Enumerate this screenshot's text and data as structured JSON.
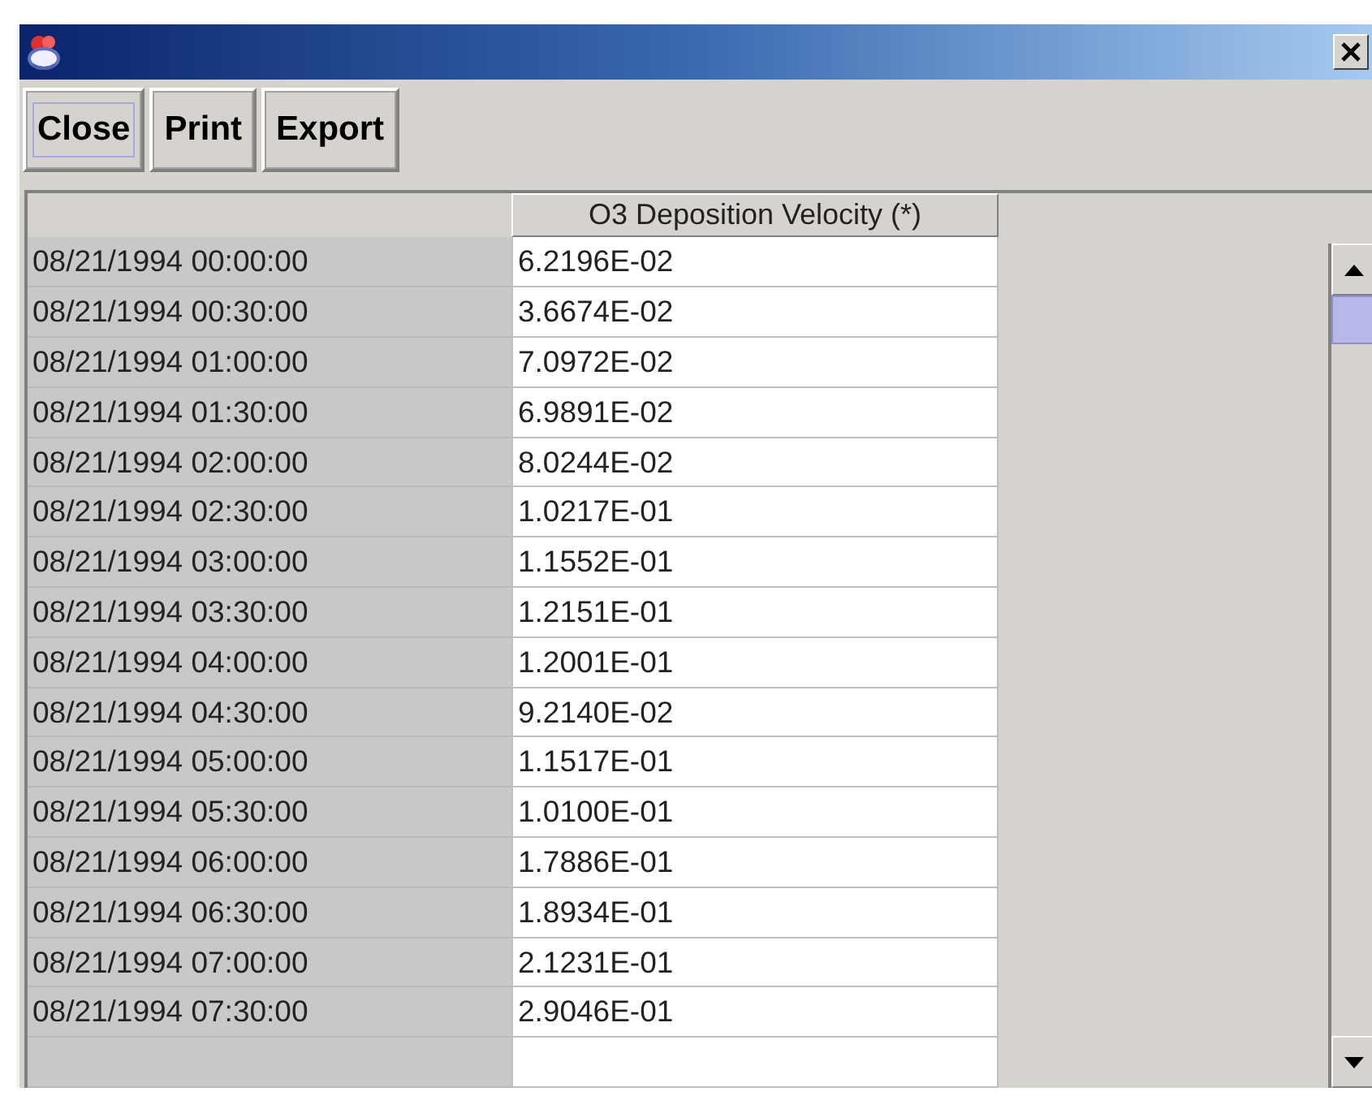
{
  "toolbar": {
    "buttons": [
      {
        "label": "Close",
        "focused": true
      },
      {
        "label": "Print",
        "focused": false
      },
      {
        "label": "Export",
        "focused": false
      }
    ]
  },
  "table": {
    "columns": [
      "O3 Deposition Velocity (*)"
    ],
    "rows": [
      {
        "time": "08/21/1994 00:00:00",
        "value": "6.2196E-02"
      },
      {
        "time": "08/21/1994 00:30:00",
        "value": "3.6674E-02"
      },
      {
        "time": "08/21/1994 01:00:00",
        "value": "7.0972E-02"
      },
      {
        "time": "08/21/1994 01:30:00",
        "value": "6.9891E-02"
      },
      {
        "time": "08/21/1994 02:00:00",
        "value": "8.0244E-02"
      },
      {
        "time": "08/21/1994 02:30:00",
        "value": "1.0217E-01"
      },
      {
        "time": "08/21/1994 03:00:00",
        "value": "1.1552E-01"
      },
      {
        "time": "08/21/1994 03:30:00",
        "value": "1.2151E-01"
      },
      {
        "time": "08/21/1994 04:00:00",
        "value": "1.2001E-01"
      },
      {
        "time": "08/21/1994 04:30:00",
        "value": "9.2140E-02"
      },
      {
        "time": "08/21/1994 05:00:00",
        "value": "1.1517E-01"
      },
      {
        "time": "08/21/1994 05:30:00",
        "value": "1.0100E-01"
      },
      {
        "time": "08/21/1994 06:00:00",
        "value": "1.7886E-01"
      },
      {
        "time": "08/21/1994 06:30:00",
        "value": "1.8934E-01"
      },
      {
        "time": "08/21/1994 07:00:00",
        "value": "2.1231E-01"
      },
      {
        "time": "08/21/1994 07:30:00",
        "value": "2.9046E-01"
      }
    ]
  }
}
